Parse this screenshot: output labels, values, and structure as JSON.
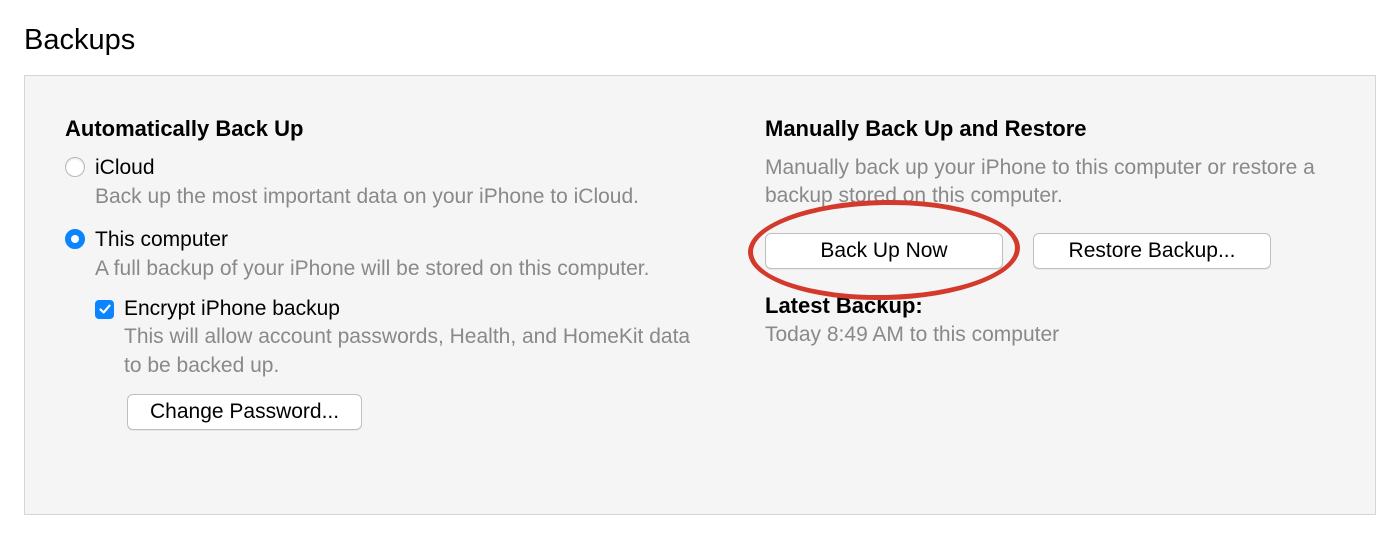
{
  "section_title": "Backups",
  "auto": {
    "heading": "Automatically Back Up",
    "icloud": {
      "label": "iCloud",
      "desc": "Back up the most important data on your iPhone to iCloud.",
      "selected": false
    },
    "computer": {
      "label": "This computer",
      "desc": "A full backup of your iPhone will be stored on this computer.",
      "selected": true
    },
    "encrypt": {
      "label": "Encrypt iPhone backup",
      "desc": "This will allow account passwords, Health, and HomeKit data to be backed up.",
      "checked": true
    },
    "change_password_label": "Change Password..."
  },
  "manual": {
    "heading": "Manually Back Up and Restore",
    "desc": "Manually back up your iPhone to this computer or restore a backup stored on this computer.",
    "backup_now_label": "Back Up Now",
    "restore_label": "Restore Backup...",
    "latest_heading": "Latest Backup:",
    "latest_text": "Today 8:49 AM to this computer"
  }
}
